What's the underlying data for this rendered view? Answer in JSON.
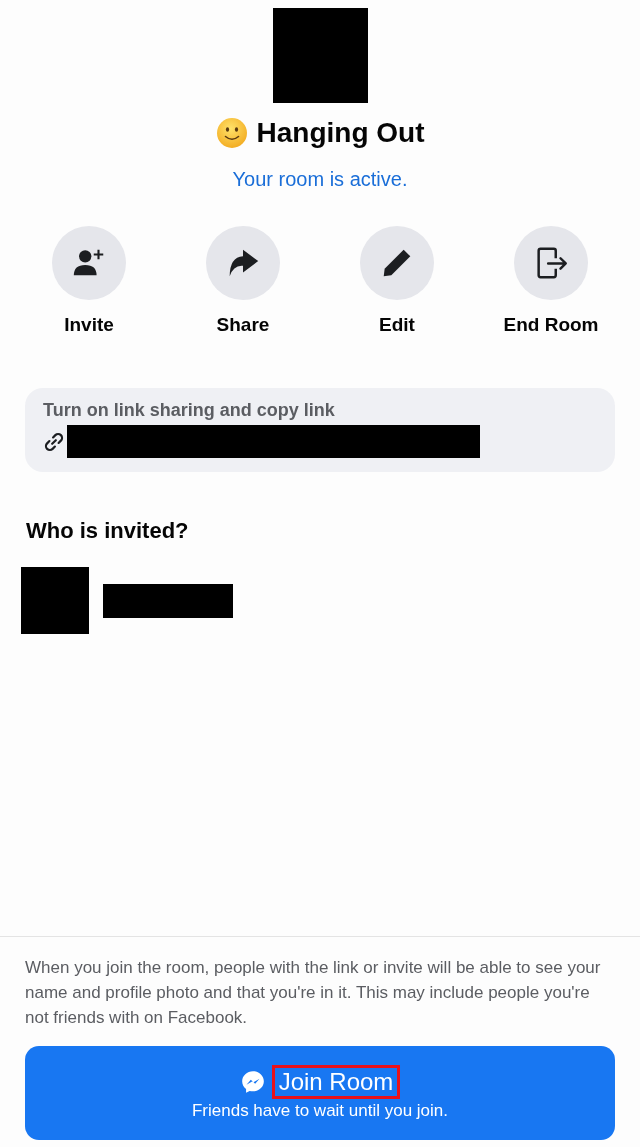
{
  "header": {
    "cover": {
      "kind": "redacted"
    },
    "title": "Hanging Out",
    "status": "Your room is active."
  },
  "actions": [
    {
      "kind": "invite",
      "label": "Invite"
    },
    {
      "kind": "share",
      "label": "Share"
    },
    {
      "kind": "edit",
      "label": "Edit"
    },
    {
      "kind": "end",
      "label": "End Room"
    }
  ],
  "link_card": {
    "label": "Turn on link sharing and copy link",
    "link": {
      "kind": "redacted"
    }
  },
  "invited": {
    "heading": "Who is invited?",
    "people": [
      {
        "kind": "redacted"
      }
    ]
  },
  "notice": "When you join the room, people with the link or invite will be able to see your name and profile photo and that you're in it. This may include people you're not friends with on Facebook.",
  "join_button": {
    "label": "Join Room",
    "subtitle": "Friends have to wait until you join.",
    "highlighted": true
  }
}
